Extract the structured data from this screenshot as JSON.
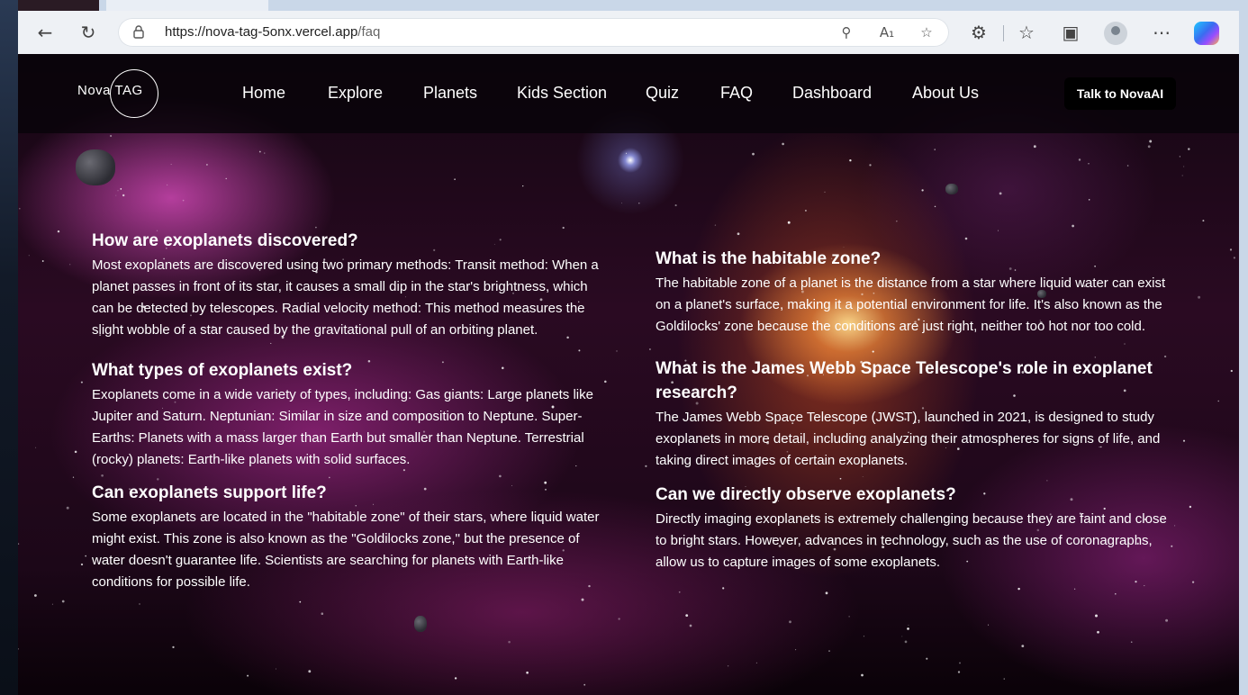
{
  "browser": {
    "url_host": "https://nova-tag-5onx.vercel.app",
    "url_path": "/faq",
    "icons": [
      "back-arrow-icon",
      "refresh-icon",
      "lock-icon",
      "zoom-out-icon",
      "read-aloud-icon",
      "favorite-star-icon",
      "extensions-icon",
      "favorites-list-icon",
      "screenshot-icon",
      "profile-icon",
      "more-icon",
      "copilot-icon"
    ]
  },
  "nav": {
    "logo_text_a": "Nova",
    "logo_text_b": "TAG",
    "links": [
      "Home",
      "Explore",
      "Planets",
      "Kids Section",
      "Quiz",
      "FAQ",
      "Dashboard",
      "About Us"
    ],
    "cta": "Talk to NovaAI"
  },
  "faq": {
    "left": [
      {
        "q": "How are exoplanets discovered?",
        "a": "Most exoplanets are discovered using two primary methods: Transit method: When a planet passes in front of its star, it causes a small dip in the star's brightness, which can be detected by telescopes. Radial velocity method: This method measures the slight wobble of a star caused by the gravitational pull of an orbiting planet."
      },
      {
        "q": "What types of exoplanets exist?",
        "a": "Exoplanets come in a wide variety of types, including: Gas giants: Large planets like Jupiter and Saturn. Neptunian: Similar in size and composition to Neptune. Super-Earths: Planets with a mass larger than Earth but smaller than Neptune. Terrestrial (rocky) planets: Earth-like planets with solid surfaces."
      },
      {
        "q": "Can exoplanets support life?",
        "a": "Some exoplanets are located in the \"habitable zone\" of their stars, where liquid water might exist. This zone is also known as the \"Goldilocks zone,\" but the presence of water doesn't guarantee life. Scientists are searching for planets with Earth-like conditions for possible life."
      }
    ],
    "right": [
      {
        "q": "What is the habitable zone?",
        "a": "The habitable zone of a planet is the distance from a star where liquid water can exist on a planet's surface, making it a potential environment for life. It's also known as the Goldilocks' zone because the conditions are just right, neither too hot nor too cold."
      },
      {
        "q": "What is the James Webb Space Telescope's role in exoplanet research?",
        "a": "The James Webb Space Telescope (JWST), launched in 2021, is designed to study exoplanets in more detail, including analyzing their atmospheres for signs of life, and taking direct images of certain exoplanets."
      },
      {
        "q": "Can we directly observe exoplanets?",
        "a": "Directly imaging exoplanets is extremely challenging because they are faint and close to bright stars. However, advances in technology, such as the use of coronagraphs, allow us to capture images of some exoplanets."
      }
    ]
  }
}
